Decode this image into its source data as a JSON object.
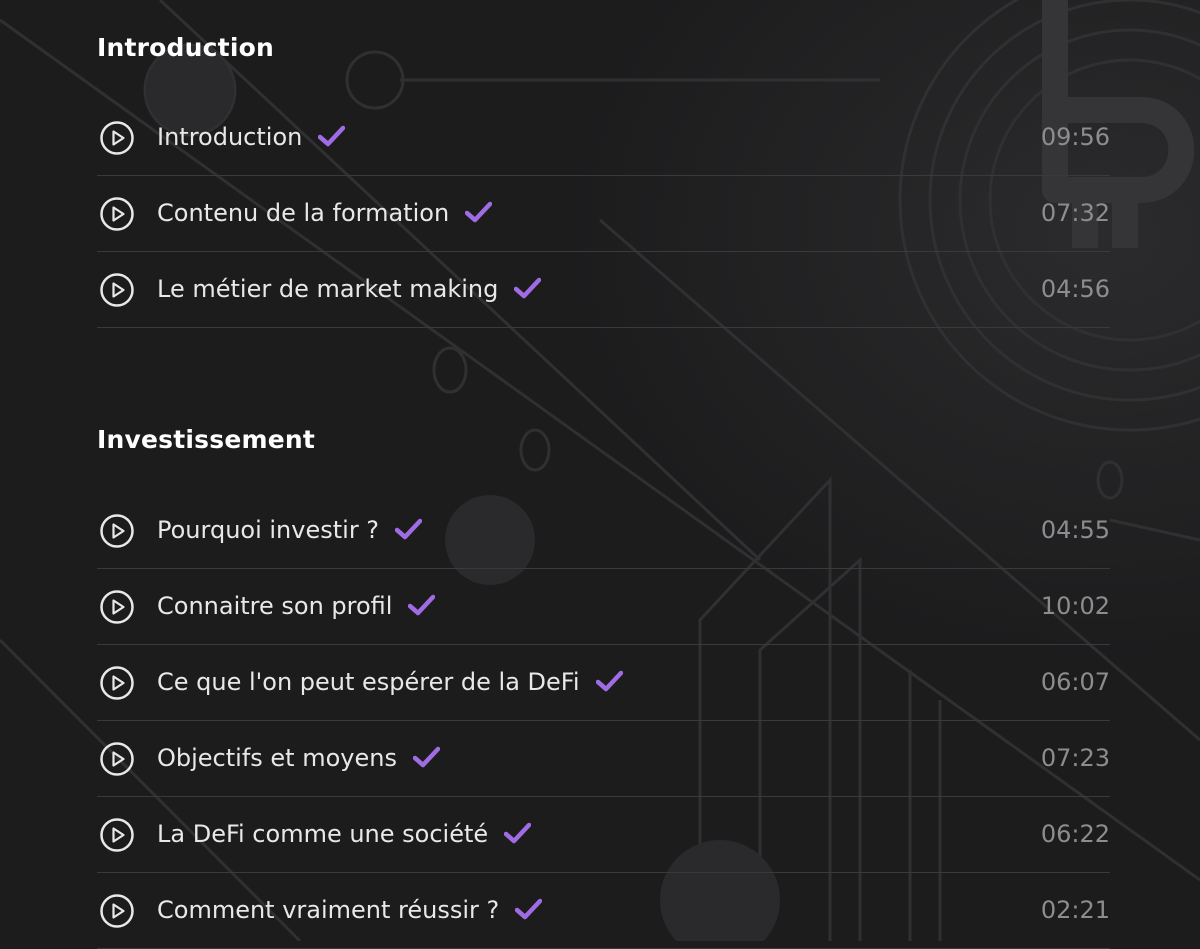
{
  "sections": [
    {
      "title": "Introduction",
      "lessons": [
        {
          "title": "Introduction",
          "duration": "09:56",
          "completed": true
        },
        {
          "title": "Contenu de la formation",
          "duration": "07:32",
          "completed": true
        },
        {
          "title": "Le métier de market making",
          "duration": "04:56",
          "completed": true
        }
      ]
    },
    {
      "title": "Investissement",
      "lessons": [
        {
          "title": "Pourquoi investir ?",
          "duration": "04:55",
          "completed": true
        },
        {
          "title": "Connaitre son profil",
          "duration": "10:02",
          "completed": true
        },
        {
          "title": "Ce que l'on peut espérer de la DeFi",
          "duration": "06:07",
          "completed": true
        },
        {
          "title": "Objectifs et moyens",
          "duration": "07:23",
          "completed": true
        },
        {
          "title": "La DeFi comme une société",
          "duration": "06:22",
          "completed": true
        },
        {
          "title": "Comment vraiment réussir ?",
          "duration": "02:21",
          "completed": true
        }
      ]
    }
  ],
  "icons": {
    "play": "play-circle-icon",
    "completed": "checkmark-icon",
    "background": "bitcoin-circuit-background"
  },
  "colors": {
    "background": "#1c1c1d",
    "accent": "#a06ce4",
    "title": "#ffffff",
    "text": "#e8e8e8",
    "duration": "#8d8d90",
    "divider": "#3a3a3c"
  }
}
